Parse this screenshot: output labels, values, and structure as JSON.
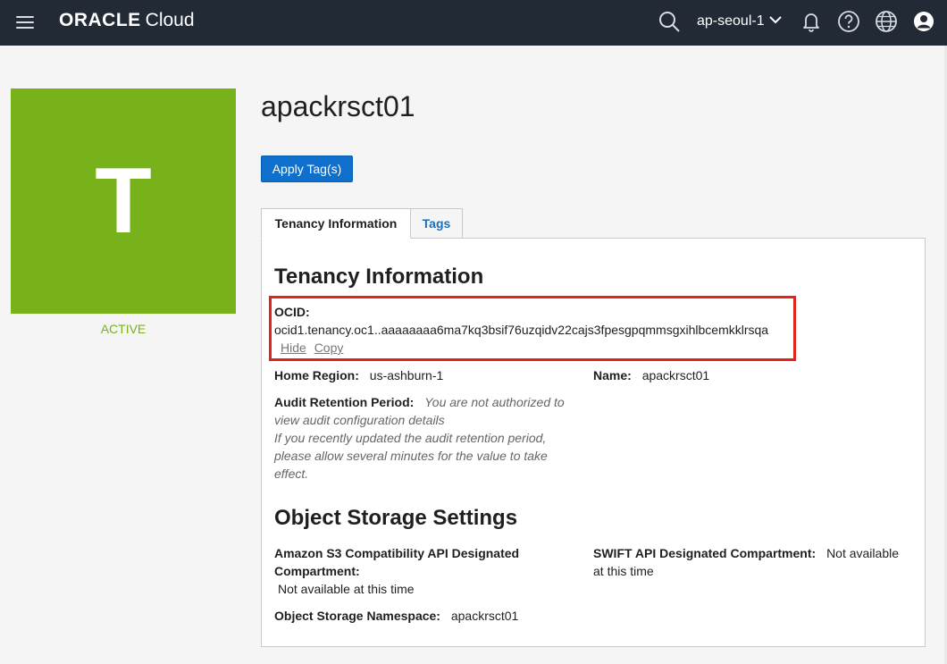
{
  "header": {
    "brand_oracle": "ORACLE",
    "brand_cloud": "Cloud",
    "region": "ap-seoul-1",
    "icons": [
      "menu-icon",
      "search-icon",
      "chevron-down-icon",
      "bell-icon",
      "help-icon",
      "globe-icon",
      "user-icon"
    ]
  },
  "tile": {
    "letter": "T",
    "status": "ACTIVE",
    "color": "#77b21b"
  },
  "page": {
    "title": "apackrsct01",
    "apply_button": "Apply Tag(s)"
  },
  "tabs": [
    {
      "label": "Tenancy Information",
      "active": true
    },
    {
      "label": "Tags",
      "active": false
    }
  ],
  "tenancy": {
    "section_title": "Tenancy Information",
    "ocid_label": "OCID:",
    "ocid_value": "ocid1.tenancy.oc1..aaaaaaaa6ma7kq3bsif76uzqidv22cajs3fpesgpqmmsgxihlbcemkklrsqa",
    "hide_link": "Hide",
    "copy_link": "Copy",
    "home_region_label": "Home Region:",
    "home_region_value": "us-ashburn-1",
    "name_label": "Name:",
    "name_value": "apackrsct01",
    "audit_label": "Audit Retention Period:",
    "audit_note_1": "You are not authorized to",
    "audit_note_2": "view audit configuration details",
    "audit_note_3": "If you recently updated the audit retention period,",
    "audit_note_4": "please allow several minutes for the value to take",
    "audit_note_5": "effect."
  },
  "object_storage": {
    "section_title": "Object Storage Settings",
    "s3_label_1": "Amazon S3 Compatibility API Designated",
    "s3_label_2": "Compartment:",
    "s3_value": "Not available at this time",
    "swift_label": "SWIFT API Designated Compartment:",
    "swift_value_1": "Not available",
    "swift_value_2": "at this time",
    "namespace_label": "Object Storage Namespace:",
    "namespace_value": "apackrsct01"
  },
  "colors": {
    "topbar": "#222a35",
    "accent_button": "#0f6fcc",
    "highlight_box": "#e2231a",
    "active_status": "#77b21b"
  }
}
